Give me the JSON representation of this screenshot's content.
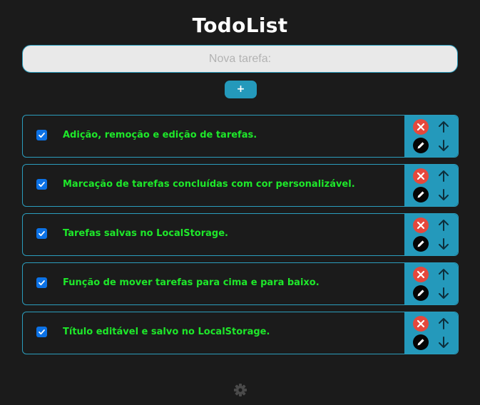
{
  "header": {
    "title": "TodoList"
  },
  "new_task": {
    "placeholder": "Nova tarefa:",
    "value": "",
    "add_label": "+"
  },
  "tasks": [
    {
      "text": "Adição, remoção e edição de tarefas.",
      "checked": true
    },
    {
      "text": "Marcação de tarefas concluídas com cor personalizável.",
      "checked": true
    },
    {
      "text": "Tarefas salvas no LocalStorage.",
      "checked": true
    },
    {
      "text": "Função de mover tarefas para cima e para baixo.",
      "checked": true
    },
    {
      "text": "Título editável e salvo no LocalStorage.",
      "checked": true
    }
  ],
  "task_actions": {
    "remove_icon": "close-icon",
    "edit_icon": "pencil-icon",
    "up_icon": "arrow-up-icon",
    "down_icon": "arrow-down-icon"
  },
  "footer": {
    "settings_icon": "gear-icon"
  },
  "colors": {
    "background": "#1b1b1b",
    "accent": "#2499bb",
    "completed_text": "#1ee82a",
    "remove": "#e5483c",
    "checkbox": "#0c72e6"
  }
}
